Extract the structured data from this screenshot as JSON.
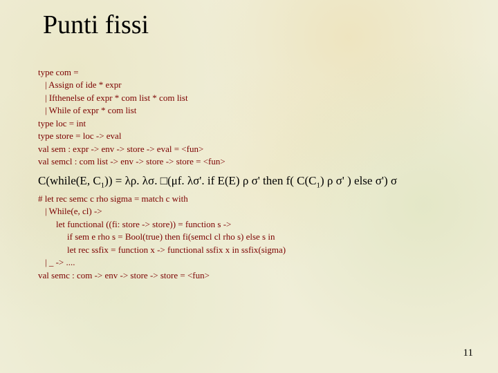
{
  "title": "Punti fissi",
  "code1": {
    "l1": "type com =",
    "l2": "| Assign of ide * expr",
    "l3": "| Ifthenelse of expr * com list * com list",
    "l4": "| While of expr * com list",
    "l5": "type loc = int",
    "l6": "type store = loc -> eval",
    "l7": "val sem : expr -> env -> store -> eval = <fun>",
    "l8": "val semcl : com list -> env -> store -> store = <fun>"
  },
  "formula": {
    "pre": "C(while(E, C",
    "sub1": "1",
    "mid1": ")) = λρ. λσ. □(μf. λσ'. if  E(E) ρ σ' then f( C(C",
    "sub2": "1",
    "mid2": ") ρ σ' ) else σ')  σ"
  },
  "code2": {
    "l1": "# let rec semc c rho sigma = match c with",
    "l2": "| While(e, cl) ->",
    "l3": "let functional ((fi: store -> store)) = function s ->",
    "l4": "if sem e rho s = Bool(true) then fi(semcl cl rho s) else s in",
    "l5": "let rec ssfix = function x -> functional ssfix x in ssfix(sigma)",
    "l6": "| _ -> ....",
    "l7": "val semc : com -> env -> store -> store = <fun>"
  },
  "page_number": "11",
  "chart_data": {
    "type": "table",
    "title": "Punti fissi",
    "rows": [
      "type com =",
      "| Assign of ide * expr",
      "| Ifthenelse of expr * com list * com list",
      "| While of expr * com list",
      "type loc = int",
      "type store = loc -> eval",
      "val sem : expr -> env -> store -> eval = <fun>",
      "val semcl : com list -> env -> store -> store = <fun>",
      "C(while(E, C1)) = λρ. λσ. □(μf. λσ'. if E(E) ρ σ' then f( C(C1) ρ σ' ) else σ') σ",
      "# let rec semc c rho sigma = match c with",
      "| While(e, cl) ->",
      "let functional ((fi: store -> store)) = function s ->",
      "if sem e rho s = Bool(true) then fi(semcl cl rho s) else s in",
      "let rec ssfix = function x -> functional ssfix x in ssfix(sigma)",
      "| _ -> ....",
      "val semc : com -> env -> store -> store = <fun>"
    ],
    "page_number": 11
  }
}
